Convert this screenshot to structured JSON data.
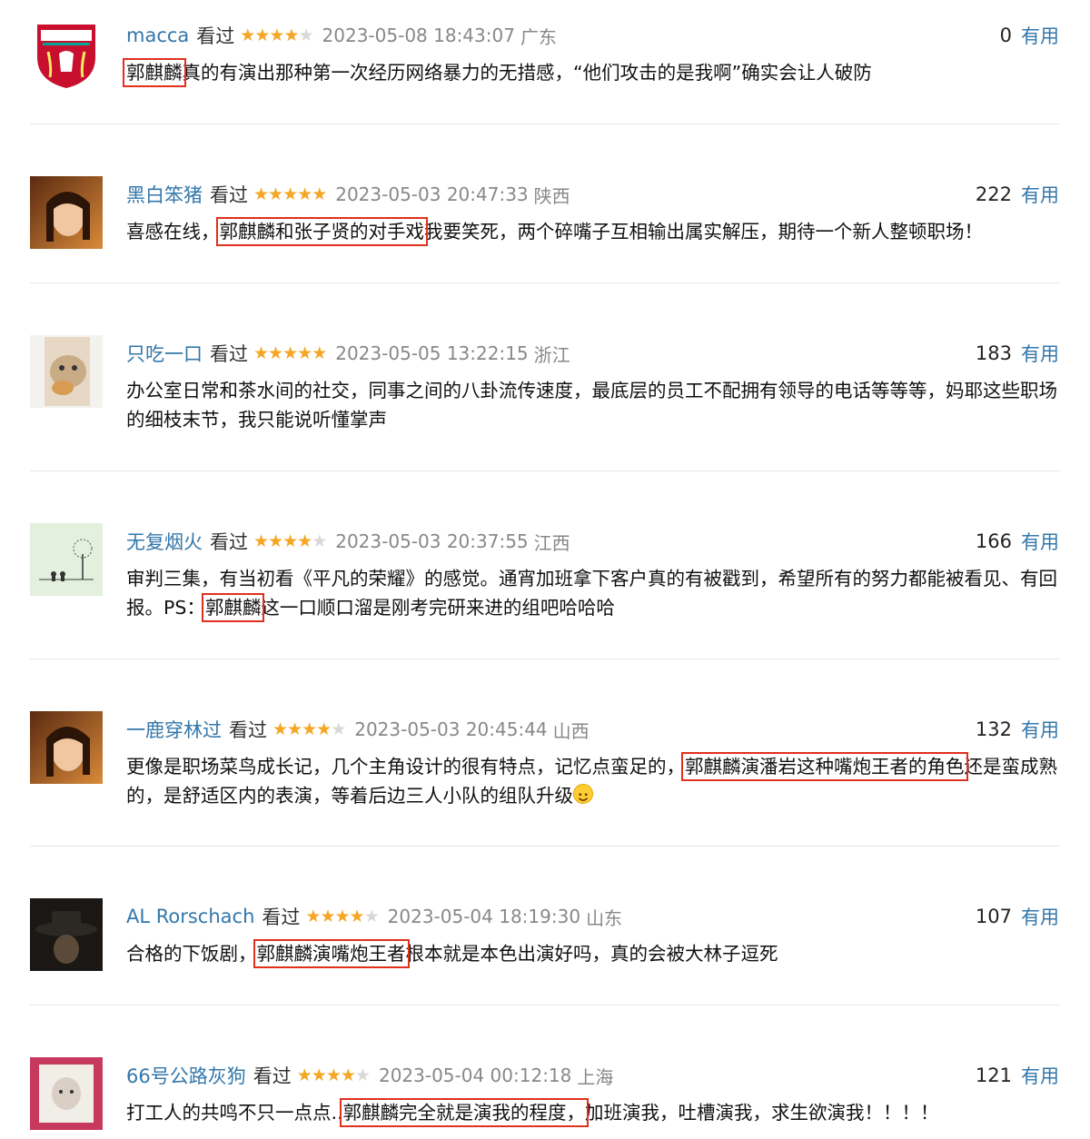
{
  "useful_label": "有用",
  "watched_label": "看过",
  "colors": {
    "accent_blue": "#3377aa",
    "star_on": "#f5a623",
    "star_off": "#d8d8d8",
    "highlight_border": "#e0301e"
  },
  "comments": [
    {
      "user": "macca",
      "stars": 4,
      "time": "2023-05-08 18:43:07",
      "location": "广东",
      "votes": "0",
      "avatar_icon": "liverpool-badge-icon",
      "avatar_text": "LIVERPOOL",
      "segments": [
        {
          "text": "郭麒麟",
          "hl": true
        },
        {
          "text": "真的有演出那种第一次经历网络暴力的无措感，“他们攻击的是我啊”确实会让人破防",
          "hl": false
        }
      ]
    },
    {
      "user": "黑白笨猪",
      "stars": 5,
      "time": "2023-05-03 20:47:33",
      "location": "陕西",
      "votes": "222",
      "avatar_icon": "user-photo-icon",
      "segments": [
        {
          "text": "喜感在线，",
          "hl": false
        },
        {
          "text": "郭麒麟和张子贤的对手戏",
          "hl": true
        },
        {
          "text": "我要笑死，两个碎嘴子互相输出属实解压，期待一个新人整顿职场！",
          "hl": false
        }
      ]
    },
    {
      "user": "只吃一口",
      "stars": 5,
      "time": "2023-05-05 13:22:15",
      "location": "浙江",
      "votes": "183",
      "avatar_icon": "cat-photo-icon",
      "segments": [
        {
          "text": "办公室日常和茶水间的社交，同事之间的八卦流传速度，最底层的员工不配拥有领导的电话等等等，妈耶这些职场的细枝末节，我只能说听懂掌声",
          "hl": false
        }
      ]
    },
    {
      "user": "无复烟火",
      "stars": 4,
      "time": "2023-05-03 20:37:55",
      "location": "江西",
      "votes": "166",
      "avatar_icon": "dandelion-illustration-icon",
      "segments": [
        {
          "text": "审判三集，有当初看《平凡的荣耀》的感觉。通宵加班拿下客户真的有被戳到，希望所有的努力都能被看见、有回报。PS：",
          "hl": false
        },
        {
          "text": "郭麒麟",
          "hl": true
        },
        {
          "text": "这一口顺口溜是刚考完研来进的组吧哈哈哈",
          "hl": false
        }
      ]
    },
    {
      "user": "一鹿穿林过",
      "stars": 4,
      "time": "2023-05-03 20:45:44",
      "location": "山西",
      "votes": "132",
      "avatar_icon": "user-photo-icon",
      "segments": [
        {
          "text": "更像是职场菜鸟成长记，几个主角设计的很有特点，记忆点蛮足的，",
          "hl": false
        },
        {
          "text": "郭麒麟演潘岩这种嘴炮王者的角色",
          "hl": true
        },
        {
          "text": "还是蛮成熟的，是舒适区内的表演，等着后边三人小队的组队升级",
          "hl": false
        }
      ],
      "emoji": "smile-emoji-icon"
    },
    {
      "user": "AL Rorschach",
      "stars": 4,
      "time": "2023-05-04 18:19:30",
      "location": "山东",
      "votes": "107",
      "avatar_icon": "hat-portrait-icon",
      "segments": [
        {
          "text": "合格的下饭剧，",
          "hl": false
        },
        {
          "text": "郭麒麟演嘴炮王者",
          "hl": true
        },
        {
          "text": "根本就是本色出演好吗，真的会被大林子逗死",
          "hl": false
        }
      ]
    },
    {
      "user": "66号公路灰狗",
      "stars": 4,
      "time": "2023-05-04 00:12:18",
      "location": "上海",
      "votes": "121",
      "avatar_icon": "baby-stamp-photo-icon",
      "segments": [
        {
          "text": "打工人的共鸣不只一点点..",
          "hl": false
        },
        {
          "text": "郭麒麟完全就是演我的程度，",
          "hl": true
        },
        {
          "text": "加班演我，吐槽演我，求生欲演我！！！！",
          "hl": false
        }
      ]
    }
  ]
}
